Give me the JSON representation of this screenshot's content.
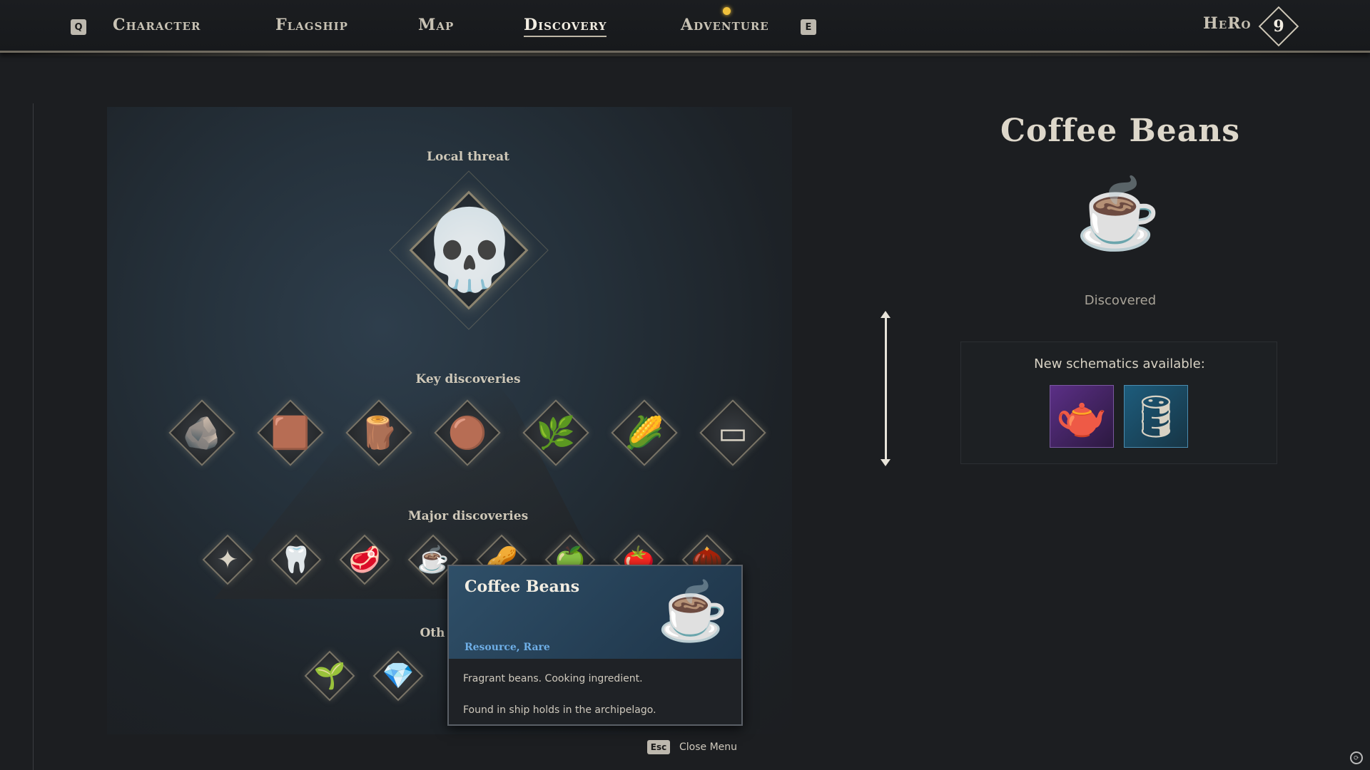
{
  "nav": {
    "prev_key": "Q",
    "next_key": "E",
    "tabs": [
      "Character",
      "Flagship",
      "Map",
      "Discovery",
      "Adventure"
    ],
    "active_tab": "Discovery",
    "hero_label": "HeRo",
    "hero_level": "9"
  },
  "discovery": {
    "local_threat_label": "Local threat",
    "key_label": "Key discoveries",
    "major_label": "Major discoveries",
    "other_label": "Oth",
    "threat_icon": "skeleton-pirate-icon",
    "key_items": [
      {
        "icon": "stone-icon",
        "glyph": "🪨"
      },
      {
        "icon": "copper-ore-icon",
        "glyph": "🟫"
      },
      {
        "icon": "log-icon",
        "glyph": "🪵"
      },
      {
        "icon": "hide-icon",
        "glyph": "🟤"
      },
      {
        "icon": "herbs-icon",
        "glyph": "🌿"
      },
      {
        "icon": "corn-icon",
        "glyph": "🌽"
      },
      {
        "icon": "iron-ingot-icon",
        "glyph": "▭"
      }
    ],
    "major_items": [
      {
        "icon": "sulfur-icon",
        "glyph": "✦"
      },
      {
        "icon": "tusk-icon",
        "glyph": "🦷"
      },
      {
        "icon": "meat-icon",
        "glyph": "🥩"
      },
      {
        "icon": "coffee-beans-icon",
        "glyph": "☕"
      },
      {
        "icon": "spice-icon",
        "glyph": "🥜"
      },
      {
        "icon": "lime-icon",
        "glyph": "🍏"
      },
      {
        "icon": "tomato-icon",
        "glyph": "🍅"
      },
      {
        "icon": "seeds-icon",
        "glyph": "🌰"
      }
    ],
    "other_items": [
      {
        "icon": "aloe-icon",
        "glyph": "🌱"
      },
      {
        "icon": "crystal-icon",
        "glyph": "💎"
      }
    ]
  },
  "tooltip": {
    "title": "Coffee Beans",
    "tags": "Resource, Rare",
    "description": "Fragrant beans. Cooking ingredient.",
    "location": "Found in ship holds in the archipelago."
  },
  "details": {
    "title": "Coffee Beans",
    "status": "Discovered",
    "schematics_label": "New schematics available:",
    "schematics": [
      {
        "icon": "coffee-pot-icon",
        "glyph": "🫖",
        "rarity_color": "#5b2f86"
      },
      {
        "icon": "barrel-icon",
        "glyph": "🛢",
        "rarity_color": "#1d5c7c"
      }
    ]
  },
  "footer": {
    "esc_key": "Esc",
    "close_label": "Close Menu"
  }
}
